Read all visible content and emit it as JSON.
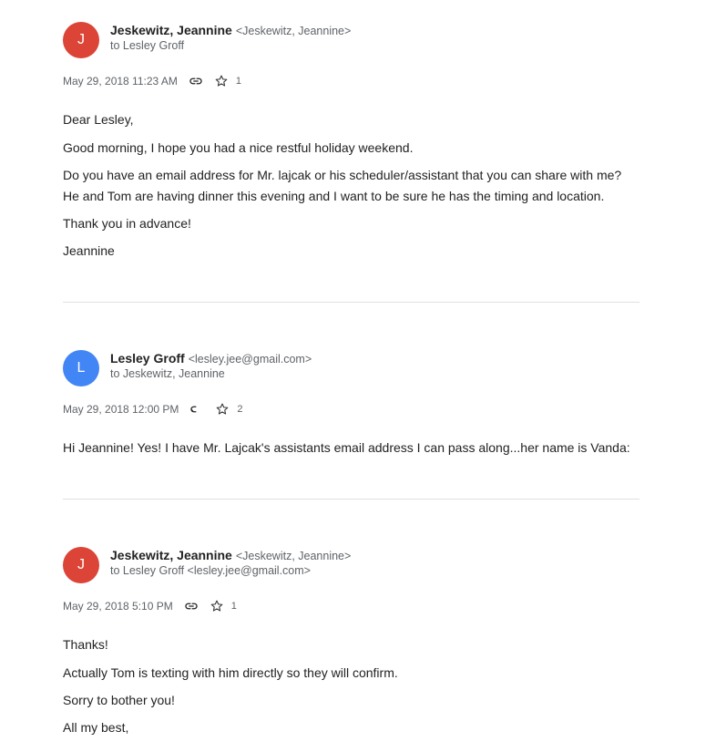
{
  "colors": {
    "avatar_red": "#db4437",
    "avatar_blue": "#4285f4",
    "divider": "#e0e0e0",
    "secondary_text": "#5f6368"
  },
  "emails": [
    {
      "avatar_letter": "J",
      "avatar_color": "#db4437",
      "sender_name": "Jeskewitz, Jeannine",
      "sender_address": "<Jeskewitz, Jeannine>",
      "recipient": "to Lesley Groff",
      "date": "May 29, 2018 11:23 AM",
      "star_count": "1",
      "body": [
        "Dear Lesley,",
        "Good morning, I hope you had a nice restful holiday weekend.",
        "Do you have an email address for Mr. lajcak or his scheduler/assistant that you can share with me?",
        "He and Tom are having dinner this evening and I want to be sure he has the timing and location.",
        "Thank you in advance!",
        "Jeannine"
      ]
    },
    {
      "avatar_letter": "L",
      "avatar_color": "#4285f4",
      "sender_name": "Lesley Groff",
      "sender_address": "<lesley.jee@gmail.com>",
      "recipient": "to Jeskewitz, Jeannine",
      "date": "May 29, 2018 12:00 PM",
      "star_count": "2",
      "body": [
        "Hi Jeannine! Yes! I have Mr. Lajcak's assistants email address I can pass along...her name is Vanda:"
      ]
    },
    {
      "avatar_letter": "J",
      "avatar_color": "#db4437",
      "sender_name": "Jeskewitz, Jeannine",
      "sender_address": "<Jeskewitz, Jeannine>",
      "recipient": "to Lesley Groff <lesley.jee@gmail.com>",
      "date": "May 29, 2018 5:10 PM",
      "star_count": "1",
      "body": [
        "Thanks!",
        "Actually Tom is texting with him directly so they will confirm.",
        "Sorry to bother you!",
        "All my best,"
      ]
    }
  ]
}
